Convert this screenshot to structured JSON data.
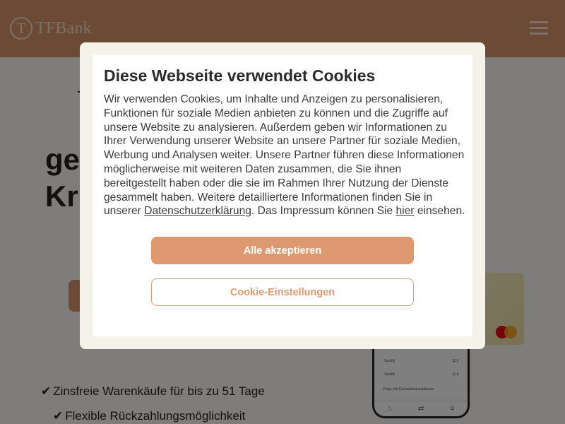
{
  "header": {
    "logo_mark": "T",
    "logo_text": "TFBank"
  },
  "hero": {
    "title_line1": "ge",
    "title_line2": "Kr"
  },
  "features": [
    "Zinsfreie Warenkäufe für bis zu 51 Tage",
    "Flexible Rückzahlungsmöglichkeit"
  ],
  "feature_check": "✔",
  "phone": {
    "rows": [
      {
        "name": "Spotify",
        "amount": "11,9"
      },
      {
        "name": "Spotify",
        "amount": "11,9"
      }
    ],
    "footer_text": "Zeige alle Einkaufstransaktionen"
  },
  "cookie_modal": {
    "title": "Diese Webseite verwendet Cookies",
    "text_main": "Wir verwenden Cookies, um Inhalte und Anzeigen zu personalisieren, Funktionen für soziale Medien anbieten zu können und die Zugriffe auf unsere Website zu analysieren. Außerdem geben wir Informationen zu Ihrer Verwendung unserer Website an unsere Partner für soziale Medien, Werbung und Analysen weiter. Unsere Partner führen diese Informationen möglicherweise mit weiteren Daten zusammen, die Sie ihnen bereitgestellt haben oder die sie im Rahmen Ihrer Nutzung der Dienste gesammelt haben. Weitere detailliertere Informationen finden Sie in unserer ",
    "privacy_link": "Datenschutzerklärung",
    "text_mid": ". Das Impressum können Sie ",
    "imprint_link": "hier",
    "text_end": " einsehen.",
    "accept_label": "Alle akzeptieren",
    "settings_label": "Cookie-Einstellungen"
  },
  "colors": {
    "brand": "#d9956a",
    "button": "#df9970"
  }
}
